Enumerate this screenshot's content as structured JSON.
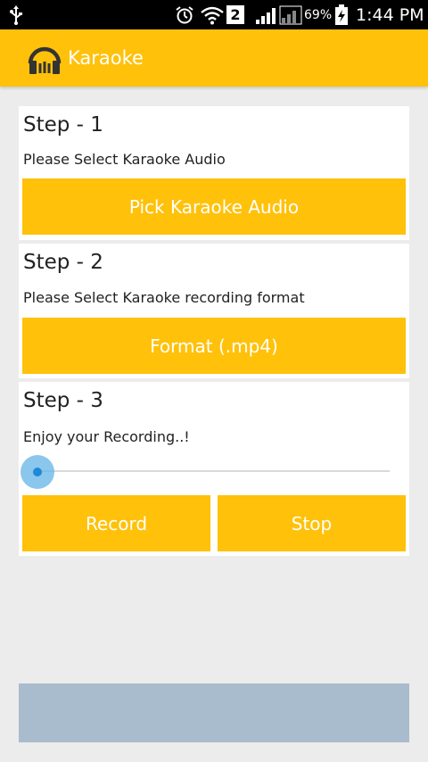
{
  "status_bar": {
    "badge": "2",
    "battery": "69%",
    "time": "1:44 PM",
    "icons": [
      "usb-icon",
      "alarm-icon",
      "wifi-icon",
      "signal-icon",
      "battery-icon"
    ]
  },
  "app_bar": {
    "title": "Karaoke",
    "icon": "headphones-icon",
    "color": "#ffc10a"
  },
  "steps": [
    {
      "title": "Step - 1",
      "description": "Please Select Karaoke Audio",
      "button_label": "Pick Karaoke Audio"
    },
    {
      "title": "Step - 2",
      "description": "Please Select Karaoke recording format",
      "button_label": "Format (.mp4)"
    },
    {
      "title": "Step - 3",
      "description": "Enjoy your Recording..!",
      "progress": 0,
      "record_label": "Record",
      "stop_label": "Stop"
    }
  ],
  "colors": {
    "accent": "#ffc10a",
    "background": "#ececec",
    "slider": "#1e88d9",
    "ad_banner": "#a9bccd"
  }
}
